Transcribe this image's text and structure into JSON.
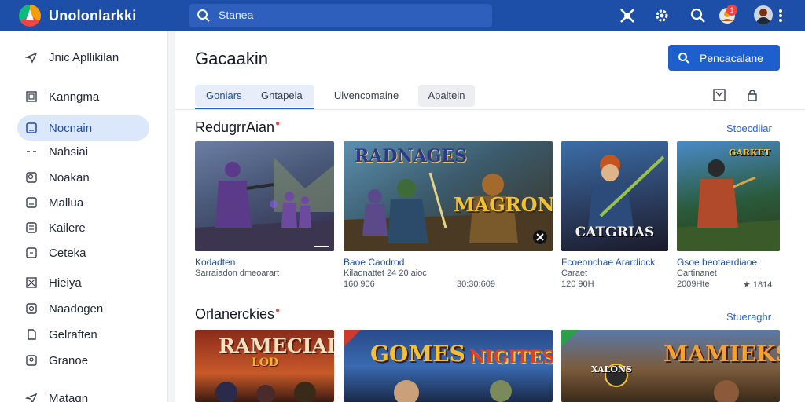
{
  "app": {
    "title": "Unolonlarkki"
  },
  "search": {
    "text": "Stanea"
  },
  "topbar": {
    "notification_count": "1"
  },
  "sidebar": {
    "items": [
      {
        "label": "Jnic Apllikilan",
        "icon": "send-icon"
      },
      {
        "label": "Kanngma",
        "icon": "grid-icon"
      },
      {
        "label": "Nocnain",
        "icon": "square-icon",
        "active": true
      },
      {
        "label": "Nahsiai",
        "icon": "dash-icon"
      },
      {
        "label": "Noakan",
        "icon": "search-box-icon"
      },
      {
        "label": "Mallua",
        "icon": "tag-icon"
      },
      {
        "label": "Kailere",
        "icon": "list-icon"
      },
      {
        "label": "Ceteka",
        "icon": "square-dash-icon"
      },
      {
        "label": "Hieiya",
        "icon": "x-box-icon"
      },
      {
        "label": "Naadogen",
        "icon": "circle-box-icon"
      },
      {
        "label": "Gelraften",
        "icon": "doc-icon"
      },
      {
        "label": "Granoe",
        "icon": "person-box-icon"
      },
      {
        "label": "Matagn",
        "icon": "send-icon"
      }
    ]
  },
  "main": {
    "title": "Gacaakin",
    "primary_button": "Pencacalane",
    "tabs": [
      "Goniars",
      "Gntapeia",
      "Ulvencomaine",
      "Apaltein"
    ]
  },
  "sections": [
    {
      "title": "RedugrrAian",
      "see_all": "Stoecdiiar",
      "cards": [
        {
          "title": "Kodadten",
          "sub": "Sarraiadon dmeoarart",
          "meta1": "",
          "meta2": "",
          "meta3": ""
        },
        {
          "title": "Baoe Caodrod",
          "sub": "Kilaonattet 24 20 aioc",
          "meta1": "160 906",
          "meta2": "30:30:609",
          "meta3": "",
          "art": "RADNAGES",
          "art2": "MAGRON"
        },
        {
          "title": "Fcoeonchae Arardiock",
          "sub": "Caraet",
          "meta1": "120 90H",
          "meta2": "",
          "meta3": "",
          "art": "CATGRIAS"
        },
        {
          "title": "Gsoe beotaerdiaoe",
          "sub": "Cartinanet",
          "meta1": "2009Hte",
          "meta2": "★ 1814",
          "meta3": "",
          "art": "GARKET"
        }
      ]
    },
    {
      "title": "Orlanerckies",
      "see_all": "Stueraghr",
      "cards": [
        {
          "art": "RAMECIAI",
          "art2": "LOD"
        },
        {
          "art": "GOMES",
          "art2": "NIGITES"
        },
        {
          "art": "MAMIEKS",
          "art2": "XALONS"
        }
      ]
    }
  ],
  "colors": {
    "brand": "#1e4fa8",
    "accent": "#1e5fce",
    "active_bg": "#dbe7fb"
  }
}
